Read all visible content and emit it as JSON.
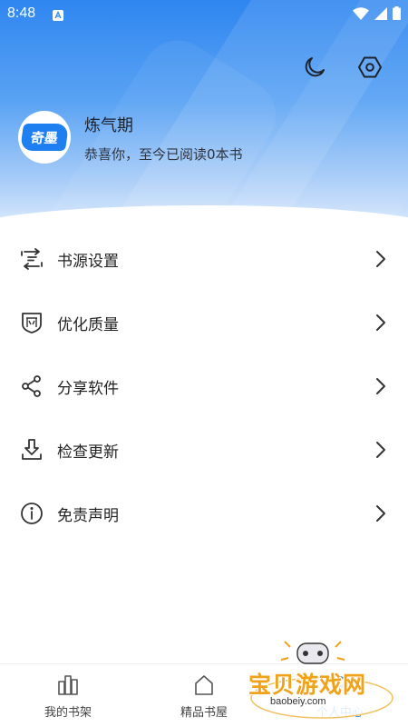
{
  "status_bar": {
    "time": "8:48",
    "icons": [
      "app-notification-icon",
      "wifi-icon",
      "signal-icon",
      "battery-icon"
    ]
  },
  "header": {
    "actions": [
      "moon-icon",
      "settings-hex-icon"
    ],
    "avatar_logo_text": "奇墨",
    "profile_name": "炼气期",
    "profile_subtitle": "恭喜你，至今已阅读0本书"
  },
  "menu": {
    "items": [
      {
        "label": "书源设置",
        "icon": "book-source-icon"
      },
      {
        "label": "优化质量",
        "icon": "shield-quality-icon"
      },
      {
        "label": "分享软件",
        "icon": "share-icon"
      },
      {
        "label": "检查更新",
        "icon": "download-update-icon"
      },
      {
        "label": "免责声明",
        "icon": "info-icon"
      }
    ]
  },
  "bottom_nav": {
    "items": [
      {
        "label": "我的书架",
        "icon": "bookshelf-icon",
        "active": false
      },
      {
        "label": "精品书屋",
        "icon": "house-icon",
        "active": false
      },
      {
        "label": "个人中心",
        "icon": "person-icon",
        "active": true
      }
    ]
  },
  "watermark": {
    "text": "宝贝游戏网",
    "url": "baobeiy.com"
  },
  "colors": {
    "accent": "#2f86f0",
    "header_top": "#2f86f0",
    "header_bottom": "#dbeafc",
    "watermark": "#f0a21a"
  }
}
